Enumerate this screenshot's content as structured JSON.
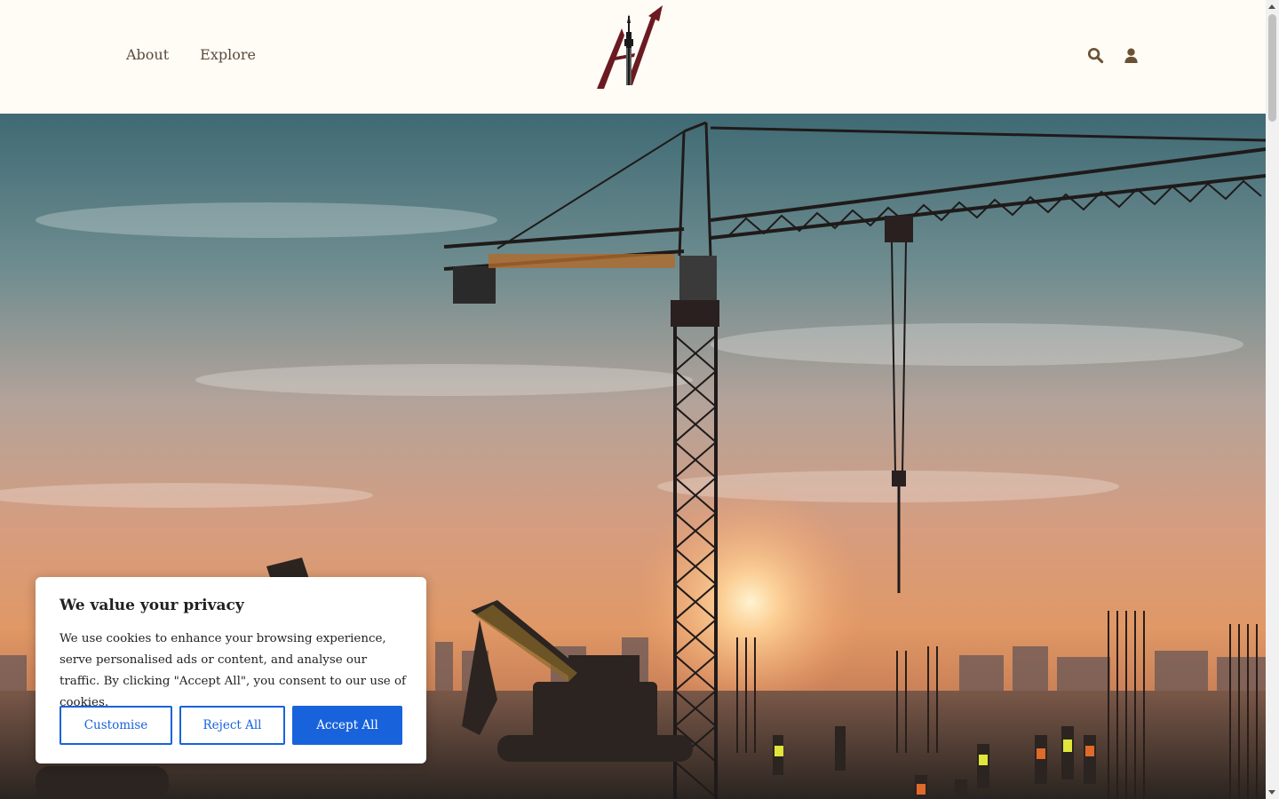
{
  "header": {
    "nav": [
      {
        "label": "About"
      },
      {
        "label": "Explore"
      }
    ],
    "icons": [
      "search-icon",
      "user-icon"
    ],
    "brand_colors": {
      "logo_red": "#6b1a22",
      "logo_dark": "#1a1a1a",
      "nav_text": "#5a4a3a"
    }
  },
  "hero": {
    "image": "construction-site-crane-sunset"
  },
  "cookie_banner": {
    "title": "We value your privacy",
    "text": "We use cookies to enhance your browsing experience, serve personalised ads or content, and analyse our traffic. By clicking \"Accept All\", you consent to our use of cookies.",
    "buttons": {
      "customise": "Customise",
      "reject": "Reject All",
      "accept": "Accept All"
    },
    "accent_color": "#1863dc"
  }
}
